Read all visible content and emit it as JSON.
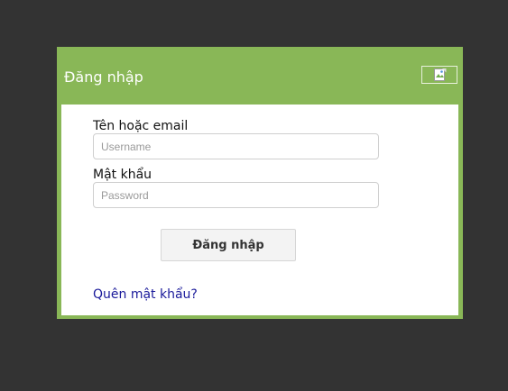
{
  "dialog": {
    "title": "Đăng nhập",
    "close_icon": "broken-image-icon"
  },
  "form": {
    "username_label": "Tên hoặc email",
    "username_placeholder": "Username",
    "password_label": "Mật khẩu",
    "password_placeholder": "Password",
    "submit_label": "Đăng nhập",
    "forgot_link": "Quên mật khẩu?"
  },
  "colors": {
    "background": "#333333",
    "dialog_accent": "#89b757",
    "link": "#1a1a9a"
  }
}
